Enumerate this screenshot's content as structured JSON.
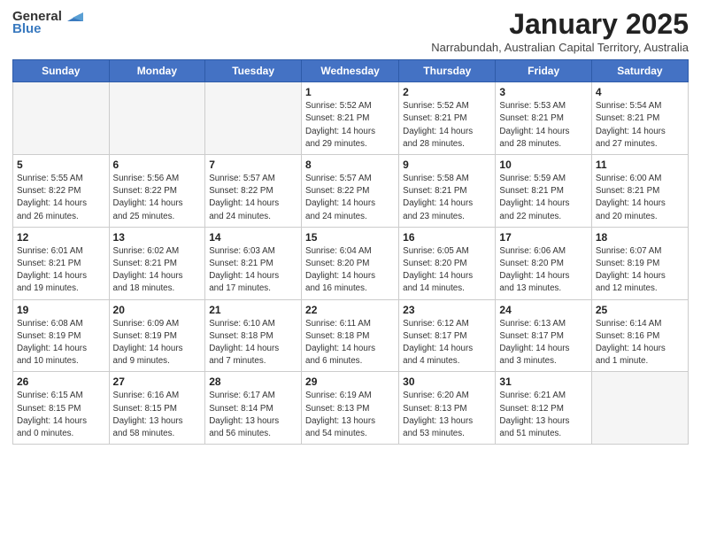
{
  "header": {
    "logo_line1": "General",
    "logo_line2": "Blue",
    "month": "January 2025",
    "location": "Narrabundah, Australian Capital Territory, Australia"
  },
  "weekdays": [
    "Sunday",
    "Monday",
    "Tuesday",
    "Wednesday",
    "Thursday",
    "Friday",
    "Saturday"
  ],
  "weeks": [
    [
      {
        "day": "",
        "info": ""
      },
      {
        "day": "",
        "info": ""
      },
      {
        "day": "",
        "info": ""
      },
      {
        "day": "1",
        "info": "Sunrise: 5:52 AM\nSunset: 8:21 PM\nDaylight: 14 hours\nand 29 minutes."
      },
      {
        "day": "2",
        "info": "Sunrise: 5:52 AM\nSunset: 8:21 PM\nDaylight: 14 hours\nand 28 minutes."
      },
      {
        "day": "3",
        "info": "Sunrise: 5:53 AM\nSunset: 8:21 PM\nDaylight: 14 hours\nand 28 minutes."
      },
      {
        "day": "4",
        "info": "Sunrise: 5:54 AM\nSunset: 8:21 PM\nDaylight: 14 hours\nand 27 minutes."
      }
    ],
    [
      {
        "day": "5",
        "info": "Sunrise: 5:55 AM\nSunset: 8:22 PM\nDaylight: 14 hours\nand 26 minutes."
      },
      {
        "day": "6",
        "info": "Sunrise: 5:56 AM\nSunset: 8:22 PM\nDaylight: 14 hours\nand 25 minutes."
      },
      {
        "day": "7",
        "info": "Sunrise: 5:57 AM\nSunset: 8:22 PM\nDaylight: 14 hours\nand 24 minutes."
      },
      {
        "day": "8",
        "info": "Sunrise: 5:57 AM\nSunset: 8:22 PM\nDaylight: 14 hours\nand 24 minutes."
      },
      {
        "day": "9",
        "info": "Sunrise: 5:58 AM\nSunset: 8:21 PM\nDaylight: 14 hours\nand 23 minutes."
      },
      {
        "day": "10",
        "info": "Sunrise: 5:59 AM\nSunset: 8:21 PM\nDaylight: 14 hours\nand 22 minutes."
      },
      {
        "day": "11",
        "info": "Sunrise: 6:00 AM\nSunset: 8:21 PM\nDaylight: 14 hours\nand 20 minutes."
      }
    ],
    [
      {
        "day": "12",
        "info": "Sunrise: 6:01 AM\nSunset: 8:21 PM\nDaylight: 14 hours\nand 19 minutes."
      },
      {
        "day": "13",
        "info": "Sunrise: 6:02 AM\nSunset: 8:21 PM\nDaylight: 14 hours\nand 18 minutes."
      },
      {
        "day": "14",
        "info": "Sunrise: 6:03 AM\nSunset: 8:21 PM\nDaylight: 14 hours\nand 17 minutes."
      },
      {
        "day": "15",
        "info": "Sunrise: 6:04 AM\nSunset: 8:20 PM\nDaylight: 14 hours\nand 16 minutes."
      },
      {
        "day": "16",
        "info": "Sunrise: 6:05 AM\nSunset: 8:20 PM\nDaylight: 14 hours\nand 14 minutes."
      },
      {
        "day": "17",
        "info": "Sunrise: 6:06 AM\nSunset: 8:20 PM\nDaylight: 14 hours\nand 13 minutes."
      },
      {
        "day": "18",
        "info": "Sunrise: 6:07 AM\nSunset: 8:19 PM\nDaylight: 14 hours\nand 12 minutes."
      }
    ],
    [
      {
        "day": "19",
        "info": "Sunrise: 6:08 AM\nSunset: 8:19 PM\nDaylight: 14 hours\nand 10 minutes."
      },
      {
        "day": "20",
        "info": "Sunrise: 6:09 AM\nSunset: 8:19 PM\nDaylight: 14 hours\nand 9 minutes."
      },
      {
        "day": "21",
        "info": "Sunrise: 6:10 AM\nSunset: 8:18 PM\nDaylight: 14 hours\nand 7 minutes."
      },
      {
        "day": "22",
        "info": "Sunrise: 6:11 AM\nSunset: 8:18 PM\nDaylight: 14 hours\nand 6 minutes."
      },
      {
        "day": "23",
        "info": "Sunrise: 6:12 AM\nSunset: 8:17 PM\nDaylight: 14 hours\nand 4 minutes."
      },
      {
        "day": "24",
        "info": "Sunrise: 6:13 AM\nSunset: 8:17 PM\nDaylight: 14 hours\nand 3 minutes."
      },
      {
        "day": "25",
        "info": "Sunrise: 6:14 AM\nSunset: 8:16 PM\nDaylight: 14 hours\nand 1 minute."
      }
    ],
    [
      {
        "day": "26",
        "info": "Sunrise: 6:15 AM\nSunset: 8:15 PM\nDaylight: 14 hours\nand 0 minutes."
      },
      {
        "day": "27",
        "info": "Sunrise: 6:16 AM\nSunset: 8:15 PM\nDaylight: 13 hours\nand 58 minutes."
      },
      {
        "day": "28",
        "info": "Sunrise: 6:17 AM\nSunset: 8:14 PM\nDaylight: 13 hours\nand 56 minutes."
      },
      {
        "day": "29",
        "info": "Sunrise: 6:19 AM\nSunset: 8:13 PM\nDaylight: 13 hours\nand 54 minutes."
      },
      {
        "day": "30",
        "info": "Sunrise: 6:20 AM\nSunset: 8:13 PM\nDaylight: 13 hours\nand 53 minutes."
      },
      {
        "day": "31",
        "info": "Sunrise: 6:21 AM\nSunset: 8:12 PM\nDaylight: 13 hours\nand 51 minutes."
      },
      {
        "day": "",
        "info": ""
      }
    ]
  ]
}
